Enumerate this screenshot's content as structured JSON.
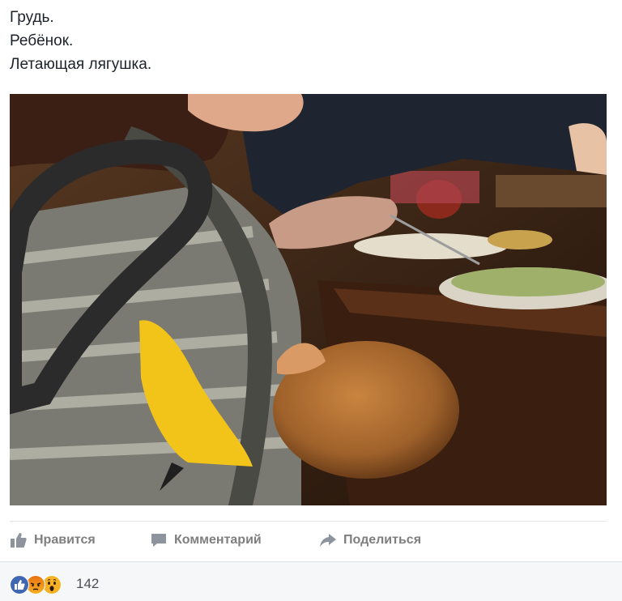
{
  "post": {
    "text_lines": [
      "Грудь.",
      "Ребёнок.",
      "Летающая лягушка."
    ]
  },
  "actions": {
    "like_label": "Нравится",
    "comment_label": "Комментарий",
    "share_label": "Поделиться"
  },
  "reactions": {
    "count": "142",
    "types": [
      "like-icon",
      "angry-icon",
      "wow-icon"
    ]
  },
  "colors": {
    "text": "#1d2129",
    "action_text": "#7f7f7f",
    "like_blue": "#4267b2",
    "reaction_yellow": "#f7b125",
    "angry_orange": "#e9710f",
    "footer_bg": "#f6f7f9"
  }
}
